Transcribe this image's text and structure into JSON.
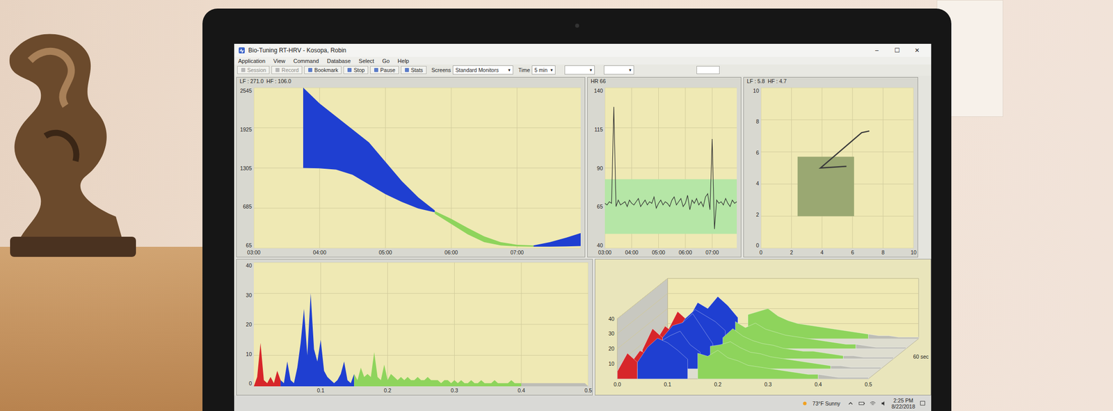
{
  "window": {
    "title": "Bio-Tuning RT-HRV - Kosopa, Robin",
    "controls": [
      "–",
      "☐",
      "✕"
    ]
  },
  "menu": [
    {
      "label": "Application"
    },
    {
      "label": "View"
    },
    {
      "label": "Command"
    },
    {
      "label": "Database"
    },
    {
      "label": "Select"
    },
    {
      "label": "Go"
    },
    {
      "label": "Help"
    }
  ],
  "toolbar": {
    "buttons": [
      {
        "label": "Session",
        "disabled": true
      },
      {
        "label": "Record",
        "disabled": true
      },
      {
        "label": "Bookmark",
        "disabled": false
      },
      {
        "label": "Stop",
        "disabled": false
      },
      {
        "label": "Pause",
        "disabled": false
      },
      {
        "label": "Stats",
        "disabled": false
      }
    ],
    "screens_label": "Screens",
    "screens_value": "Standard Monitors",
    "time_label": "Time",
    "time_value": "5 min",
    "dropdown_arrow": "▾"
  },
  "charts": {
    "rr_power": {
      "header": "LF : 271.0  HF : 106.0",
      "y_ticks": [
        "2545",
        "1925",
        "1305",
        "685",
        "65"
      ],
      "y_min": 65,
      "y_max": 2545,
      "x_min": 180,
      "x_max": 478,
      "x_ticks": [
        "03:00",
        "04:00",
        "05:00",
        "06:00",
        "07:00"
      ],
      "bands": [
        {
          "color": "#1f3fd1",
          "x": [
            225,
            240,
            255,
            270,
            285,
            300,
            315,
            330,
            345
          ],
          "upper": [
            2545,
            2300,
            2100,
            1900,
            1700,
            1400,
            1100,
            850,
            650
          ],
          "lower": [
            1305,
            1300,
            1280,
            1200,
            1050,
            900,
            780,
            680,
            620
          ]
        },
        {
          "color": "#8ed45c",
          "x": [
            345,
            360,
            375,
            390,
            405,
            420,
            435
          ],
          "upper": [
            640,
            520,
            380,
            250,
            160,
            120,
            110
          ],
          "lower": [
            600,
            440,
            280,
            160,
            110,
            95,
            90
          ]
        },
        {
          "color": "#1f3fd1",
          "x": [
            435,
            450,
            465,
            478
          ],
          "upper": [
            110,
            160,
            230,
            300
          ],
          "lower": [
            90,
            90,
            95,
            100
          ]
        }
      ]
    },
    "heart_rate": {
      "header": "HR 66",
      "y_ticks": [
        "140",
        "115",
        "90",
        "65",
        "40"
      ],
      "y_min": 40,
      "y_max": 140,
      "x_min": 180,
      "x_max": 475,
      "x_ticks": [
        "03:00",
        "04:00",
        "05:00",
        "06:00",
        "07:00"
      ],
      "target_zone": {
        "low": 49,
        "high": 83
      },
      "x_start": 180,
      "x_step": 5,
      "values": [
        68,
        67,
        69,
        68,
        128,
        66,
        70,
        67,
        68,
        69,
        66,
        70,
        68,
        67,
        69,
        71,
        66,
        68,
        70,
        67,
        69,
        68,
        72,
        65,
        68,
        70,
        67,
        69,
        68,
        66,
        70,
        72,
        67,
        69,
        71,
        66,
        68,
        73,
        64,
        70,
        68,
        71,
        67,
        69,
        66,
        72,
        74,
        64,
        108,
        52,
        70,
        68,
        69,
        67,
        71,
        68,
        66,
        70,
        68,
        69
      ]
    },
    "coherence": {
      "header": "LF : 5.8  HF : 4.7",
      "y_ticks": [
        "10",
        "8",
        "6",
        "4",
        "2",
        "0"
      ],
      "x_ticks": [
        "0",
        "2",
        "4",
        "6",
        "8",
        "10"
      ],
      "target_box": {
        "x_low": 2.4,
        "x_high": 6.1,
        "y_low": 2.0,
        "y_high": 5.7
      },
      "trace": {
        "x": [
          7.1,
          6.6,
          3.9,
          5.6
        ],
        "y": [
          7.3,
          7.2,
          5.0,
          5.1
        ]
      }
    },
    "spectrum": {
      "y_ticks": [
        "40",
        "30",
        "20",
        "10",
        "0"
      ],
      "y_max": 40,
      "x_max": 0.5,
      "x_step": 0.005,
      "x_ticks": [
        "0.1",
        "0.2",
        "0.3",
        "0.4",
        "0.5"
      ],
      "bands": [
        {
          "from": 0,
          "to": 0.04,
          "color": "#d7262a"
        },
        {
          "from": 0.04,
          "to": 0.15,
          "color": "#1f3fd1"
        },
        {
          "from": 0.15,
          "to": 0.4,
          "color": "#8ed45c"
        },
        {
          "from": 0.4,
          "to": 0.5,
          "color": "#bdbdb6"
        }
      ],
      "values": [
        0,
        3,
        14,
        2,
        1,
        3,
        1,
        5,
        2,
        1,
        8,
        2,
        1,
        6,
        14,
        25,
        10,
        30,
        12,
        8,
        15,
        5,
        3,
        2,
        1,
        2,
        4,
        8,
        2,
        1,
        4,
        2,
        6,
        3,
        4,
        3,
        11,
        3,
        2,
        7,
        2,
        4,
        3,
        2,
        3,
        2,
        3,
        2,
        2,
        3,
        2,
        2,
        3,
        2,
        2,
        2,
        1,
        2,
        2,
        1,
        2,
        1,
        2,
        1,
        1,
        2,
        1,
        1,
        2,
        1,
        1,
        1,
        2,
        1,
        1,
        1,
        1,
        2,
        1,
        1,
        1,
        1,
        1,
        1,
        1,
        1,
        1,
        1,
        1,
        1,
        1,
        1,
        1,
        1,
        1,
        1,
        1,
        1,
        1,
        1,
        0
      ]
    },
    "waterfall": {
      "y_ticks": [
        "40",
        "30",
        "20",
        "10"
      ],
      "x_ticks": [
        "0.0",
        "0.1",
        "0.2",
        "0.3",
        "0.4",
        "0.5"
      ],
      "depth_label": "60 sec",
      "x_step": 0.02,
      "spectra": [
        [
          5,
          18,
          12,
          24,
          20,
          28,
          22,
          14,
          16,
          18,
          20,
          15,
          12,
          10,
          9,
          8,
          7,
          6,
          5,
          4,
          3,
          2,
          2,
          1,
          1,
          1
        ],
        [
          4,
          15,
          10,
          20,
          26,
          22,
          18,
          12,
          18,
          14,
          17,
          13,
          11,
          9,
          8,
          7,
          6,
          5,
          4,
          3,
          3,
          2,
          1,
          1,
          1,
          1
        ],
        [
          6,
          20,
          14,
          22,
          24,
          30,
          20,
          10,
          14,
          20,
          15,
          12,
          10,
          9,
          7,
          6,
          5,
          5,
          4,
          3,
          2,
          2,
          1,
          1,
          1,
          1
        ],
        [
          3,
          12,
          9,
          18,
          22,
          25,
          16,
          11,
          15,
          16,
          18,
          14,
          11,
          10,
          8,
          7,
          6,
          5,
          4,
          3,
          2,
          2,
          1,
          1,
          1,
          1
        ],
        [
          5,
          17,
          11,
          21,
          27,
          24,
          19,
          13,
          17,
          15,
          19,
          14,
          12,
          9,
          8,
          7,
          6,
          5,
          4,
          3,
          3,
          2,
          1,
          1,
          1,
          1
        ]
      ]
    }
  },
  "taskbar": {
    "weather": "73°F  Sunny",
    "time": "2:25 PM",
    "date": "8/22/2018"
  }
}
